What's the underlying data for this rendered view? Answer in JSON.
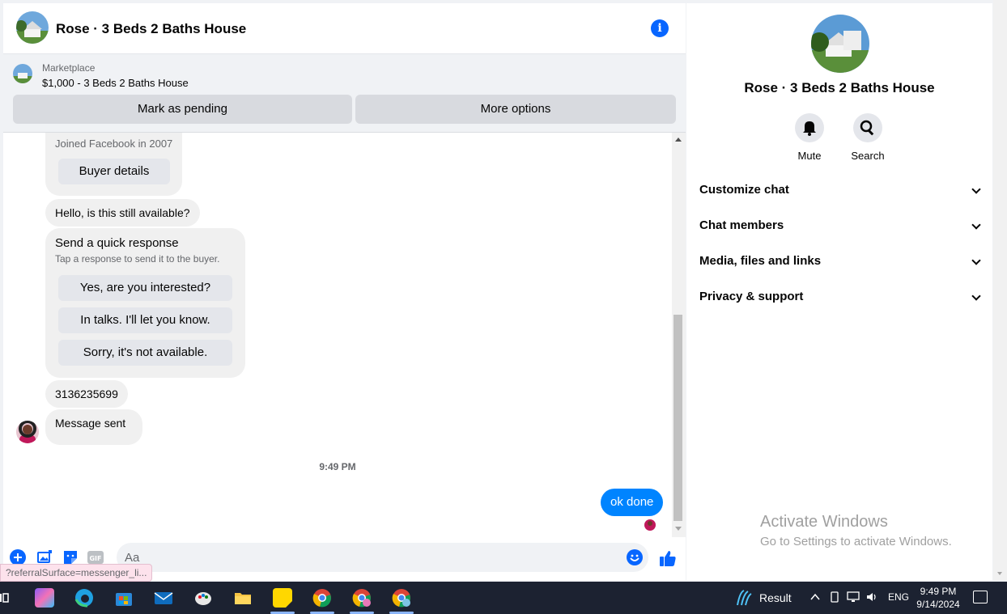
{
  "chat": {
    "title": "Rose · 3 Beds 2 Baths House",
    "marketplace": {
      "label": "Marketplace",
      "listing": "$1,000 - 3 Beds 2 Baths House",
      "mark_pending": "Mark as pending",
      "more_options": "More options"
    },
    "messages": {
      "joined": "Joined Facebook in 2007",
      "buyer_details": "Buyer details",
      "hello": "Hello, is this still available?",
      "quick_title": "Send a quick response",
      "quick_sub": "Tap a response to send it to the buyer.",
      "quick_replies": [
        "Yes, are you interested?",
        "In talks. I'll let you know.",
        "Sorry, it's not available."
      ],
      "phone": "3136235699",
      "sent": "Message sent",
      "timestamp": "9:49 PM",
      "outgoing": "ok done"
    },
    "composer": {
      "placeholder": "Aa",
      "gif_label": "GIF"
    },
    "url_tip": "?referralSurface=messenger_li..."
  },
  "info_panel": {
    "title": "Rose · 3 Beds 2 Baths House",
    "actions": {
      "mute": "Mute",
      "search": "Search"
    },
    "sections": [
      "Customize chat",
      "Chat members",
      "Media, files and links",
      "Privacy & support"
    ]
  },
  "watermark": {
    "line1": "Activate Windows",
    "line2": "Go to Settings to activate Windows."
  },
  "taskbar": {
    "weather": "Result",
    "lang": "ENG",
    "time": "9:49 PM",
    "date": "9/14/2024"
  },
  "colors": {
    "accent": "#0866ff",
    "outgoing_bubble": "#0084ff",
    "incoming_bubble": "#f0f0f0",
    "taskbar": "#1c2231"
  }
}
